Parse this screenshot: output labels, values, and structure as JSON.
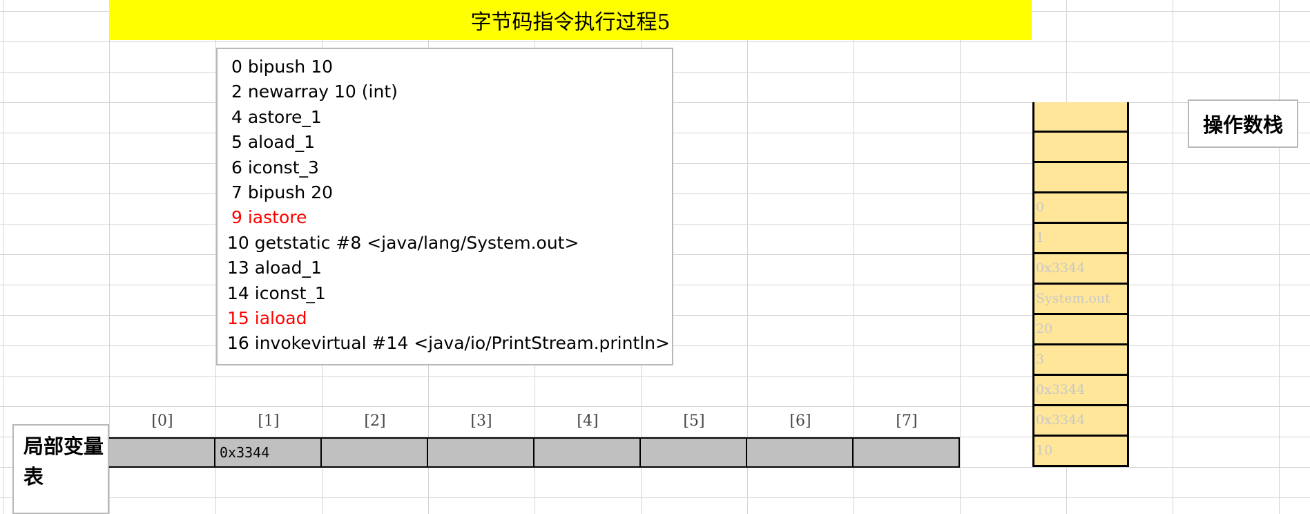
{
  "title": "字节码指令执行过程5",
  "instructions": [
    {
      "text": "0 bipush 10",
      "highlight": false
    },
    {
      "text": "2 newarray 10 (int)",
      "highlight": false
    },
    {
      "text": "4 astore_1",
      "highlight": false
    },
    {
      "text": "5 aload_1",
      "highlight": false
    },
    {
      "text": "6 iconst_3",
      "highlight": false
    },
    {
      "text": "7 bipush 20",
      "highlight": false
    },
    {
      "text": "9 iastore",
      "highlight": true
    },
    {
      "text": "10 getstatic #8 <java/lang/System.out>",
      "highlight": false
    },
    {
      "text": "13 aload_1",
      "highlight": false
    },
    {
      "text": "14 iconst_1",
      "highlight": false
    },
    {
      "text": "15 iaload",
      "highlight": true
    },
    {
      "text": "16 invokevirtual #14 <java/io/PrintStream.println>",
      "highlight": false
    }
  ],
  "operand_stack": {
    "label": "操作数栈",
    "cells": [
      "",
      "",
      "",
      "0",
      "1",
      "0x3344",
      "System.out",
      "20",
      "3",
      "0x3344",
      "0x3344",
      "10"
    ]
  },
  "local_variables": {
    "label": "局部变量表",
    "indices": [
      "[0]",
      "[1]",
      "[2]",
      "[3]",
      "[4]",
      "[5]",
      "[6]",
      "[7]"
    ],
    "values": [
      "",
      "0x3344",
      "",
      "",
      "",
      "",
      "",
      ""
    ]
  },
  "colors": {
    "title_bg": "#ffff00",
    "stack_cell_bg": "#ffe699",
    "local_cell_bg": "#c0c0c0",
    "highlight_text": "#ff0000",
    "faded_text": "#c8c8c8"
  }
}
